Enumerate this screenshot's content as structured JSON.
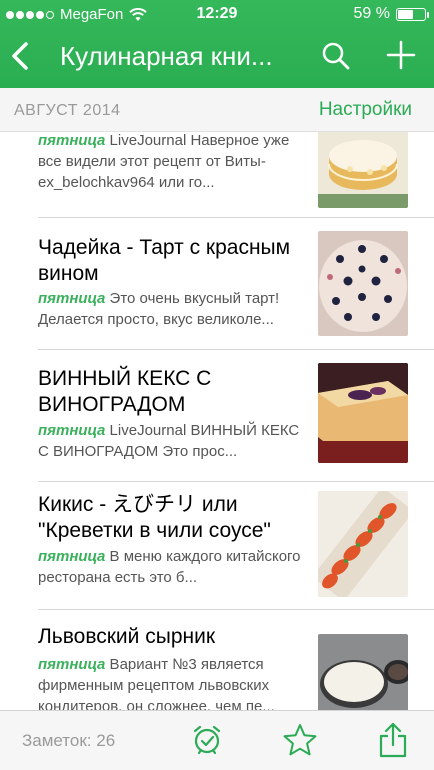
{
  "status_bar": {
    "carrier": "MegaFon",
    "time": "12:29",
    "battery_text": "59 %",
    "battery_level": 0.59,
    "signal_dots": 4,
    "signal_total": 5
  },
  "nav": {
    "title": "Кулинарная кни...",
    "back_icon": "chevron-left-icon",
    "search_icon": "search-icon",
    "add_icon": "plus-icon"
  },
  "section": {
    "date": "АВГУСТ 2014",
    "settings_label": "Настройки"
  },
  "items": [
    {
      "title": "",
      "day": "пятница",
      "excerpt": " LiveJournal Наверное уже все видели этот рецепт от Виты-ex_belochkav964 или го..."
    },
    {
      "title": "Чадейка - Тарт с красным вином",
      "day": "пятница",
      "excerpt": " Это очень вкусный тарт! Делается просто, вкус великоле..."
    },
    {
      "title": "ВИННЫЙ КЕКС С ВИНОГРАДОМ",
      "day": "пятница",
      "excerpt": " LiveJournal ВИННЫЙ КЕКС С ВИНОГРАДОМ Это прос..."
    },
    {
      "title": "Кикис - えびチリ или \"Креветки в чили соусе\"",
      "day": "пятница",
      "excerpt": " В меню каждого китайского ресторана есть это б..."
    },
    {
      "title": "Львовский сырник",
      "day": "пятница",
      "excerpt": " Вариант №3 является фирменным рецептом львовских кондитеров, он сложнее, чем пе..."
    }
  ],
  "bottom_bar": {
    "notes_count": "Заметок: 26",
    "alarm_icon": "alarm-clock-icon",
    "star_icon": "star-icon",
    "share_icon": "share-icon"
  },
  "colors": {
    "accent": "#2bab55",
    "header": "#2fb355",
    "day_label": "#3cb15d"
  }
}
